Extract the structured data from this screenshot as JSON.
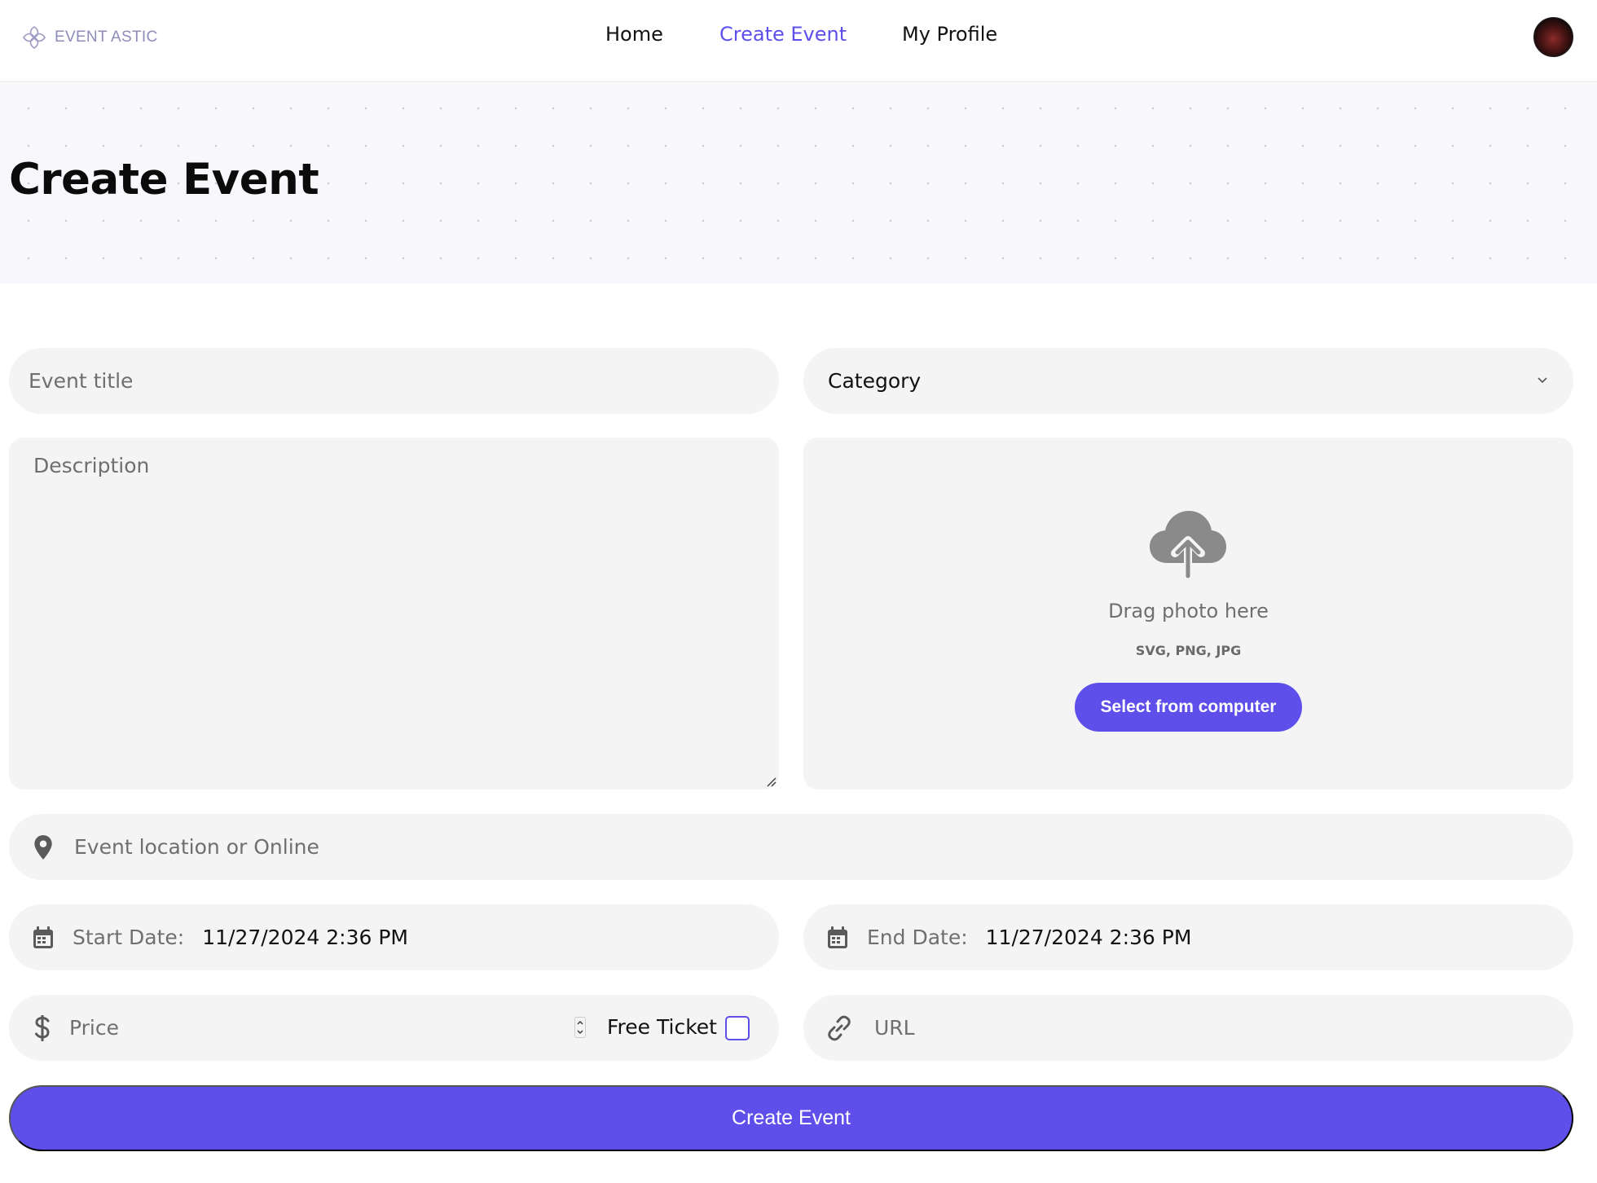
{
  "app": {
    "logo_text": "EVENT ASTIC"
  },
  "nav": {
    "home": "Home",
    "create_event": "Create Event",
    "my_profile": "My Profile",
    "active_color": "#5f4fea"
  },
  "page": {
    "title": "Create Event"
  },
  "form": {
    "title_placeholder": "Event title",
    "category_placeholder": "Category",
    "description_placeholder": "Description",
    "upload": {
      "drag_text": "Drag photo here",
      "formats": "SVG, PNG, JPG",
      "button_label": "Select from computer"
    },
    "location_placeholder": "Event location or Online",
    "start_date_label": "Start Date:",
    "start_date_value": "11/27/2024 2:36 PM",
    "end_date_label": "End Date:",
    "end_date_value": "11/27/2024 2:36 PM",
    "price_placeholder": "Price",
    "free_ticket_label": "Free Ticket",
    "free_ticket_checked": false,
    "url_placeholder": "URL",
    "submit_label": "Create Event"
  },
  "colors": {
    "accent": "#5f4fea",
    "field_bg": "#f4f4f4"
  }
}
